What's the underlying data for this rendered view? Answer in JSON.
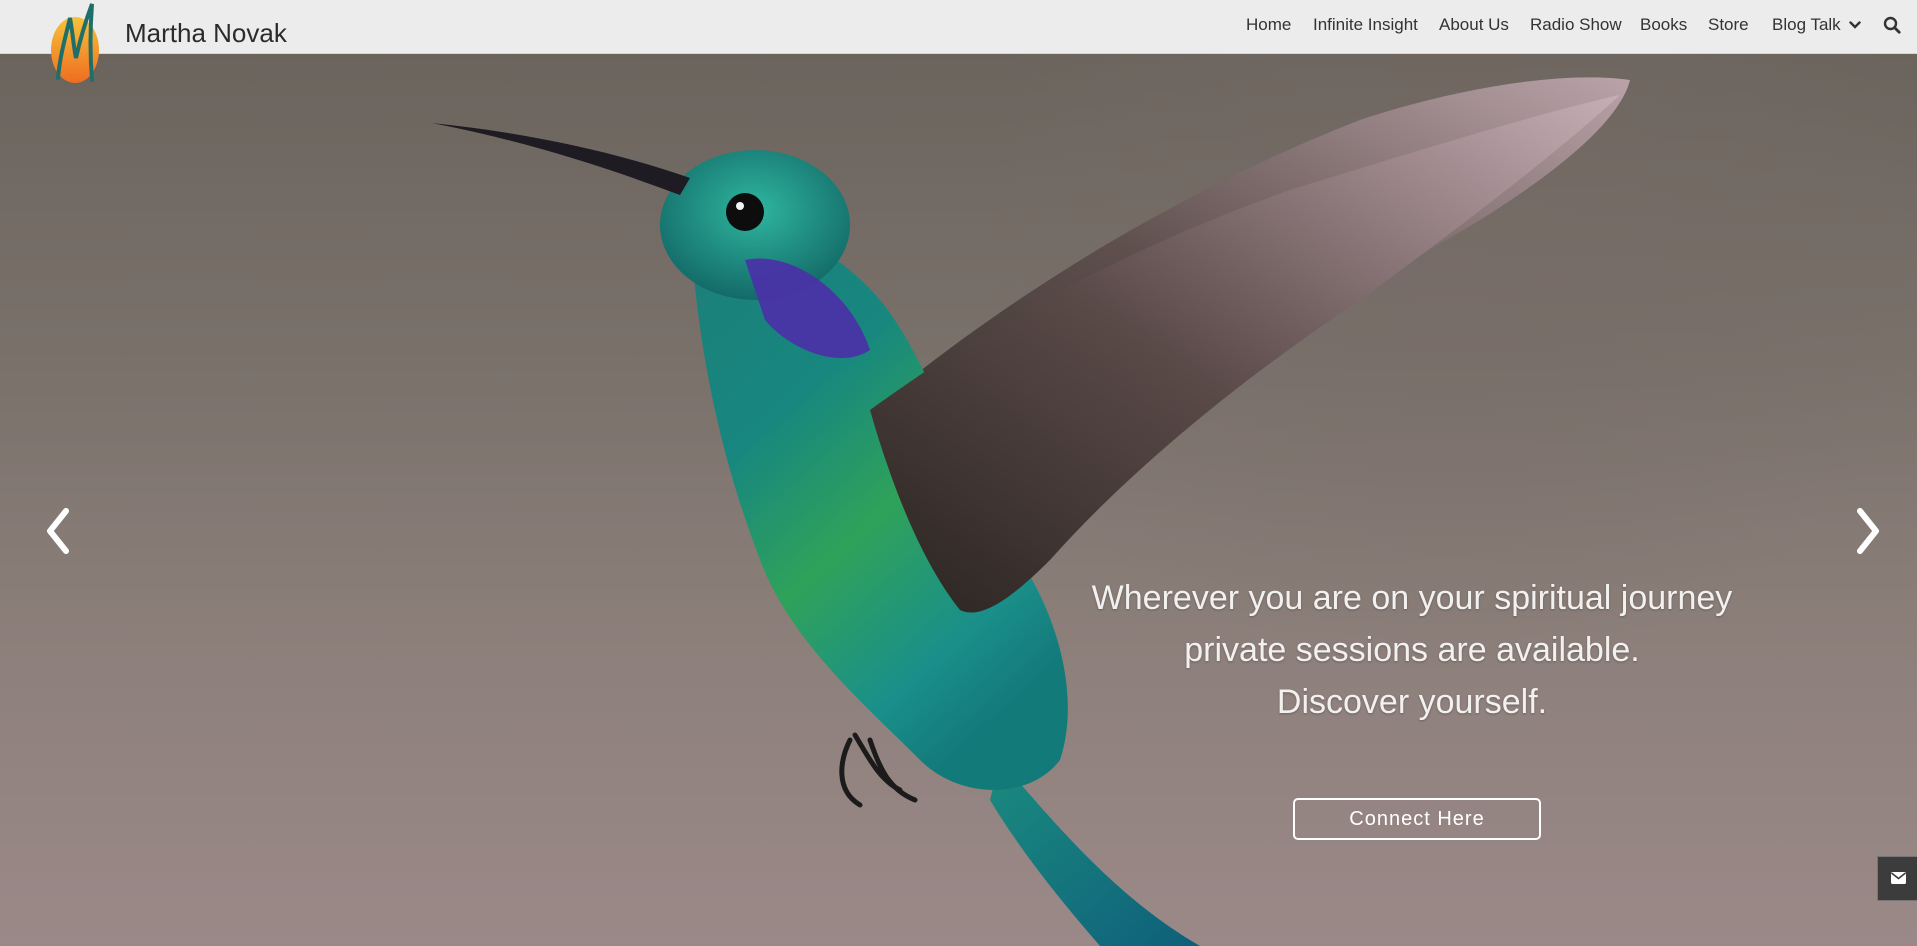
{
  "header": {
    "site_title": "Martha Novak",
    "logo_icon": "m-letter-logo",
    "nav": [
      {
        "label": "Home"
      },
      {
        "label": "Infinite Insight"
      },
      {
        "label": "About Us"
      },
      {
        "label": "Radio Show"
      },
      {
        "label": "Books"
      },
      {
        "label": "Store"
      },
      {
        "label": "Blog Talk",
        "icon": "chevron-down-icon"
      }
    ],
    "search_icon": "search-icon"
  },
  "hero": {
    "caption_lines": [
      "Wherever you are on your spiritual journey",
      "private sessions are available.",
      "Discover yourself."
    ],
    "cta_label": "Connect Here",
    "prev_icon": "chevron-left-icon",
    "next_icon": "chevron-right-icon"
  },
  "contact_tab": {
    "icon": "envelope-icon"
  },
  "colors": {
    "header_bg": "#ececec",
    "logo_orange": "#f08a24",
    "logo_teal": "#1e6f6a"
  }
}
